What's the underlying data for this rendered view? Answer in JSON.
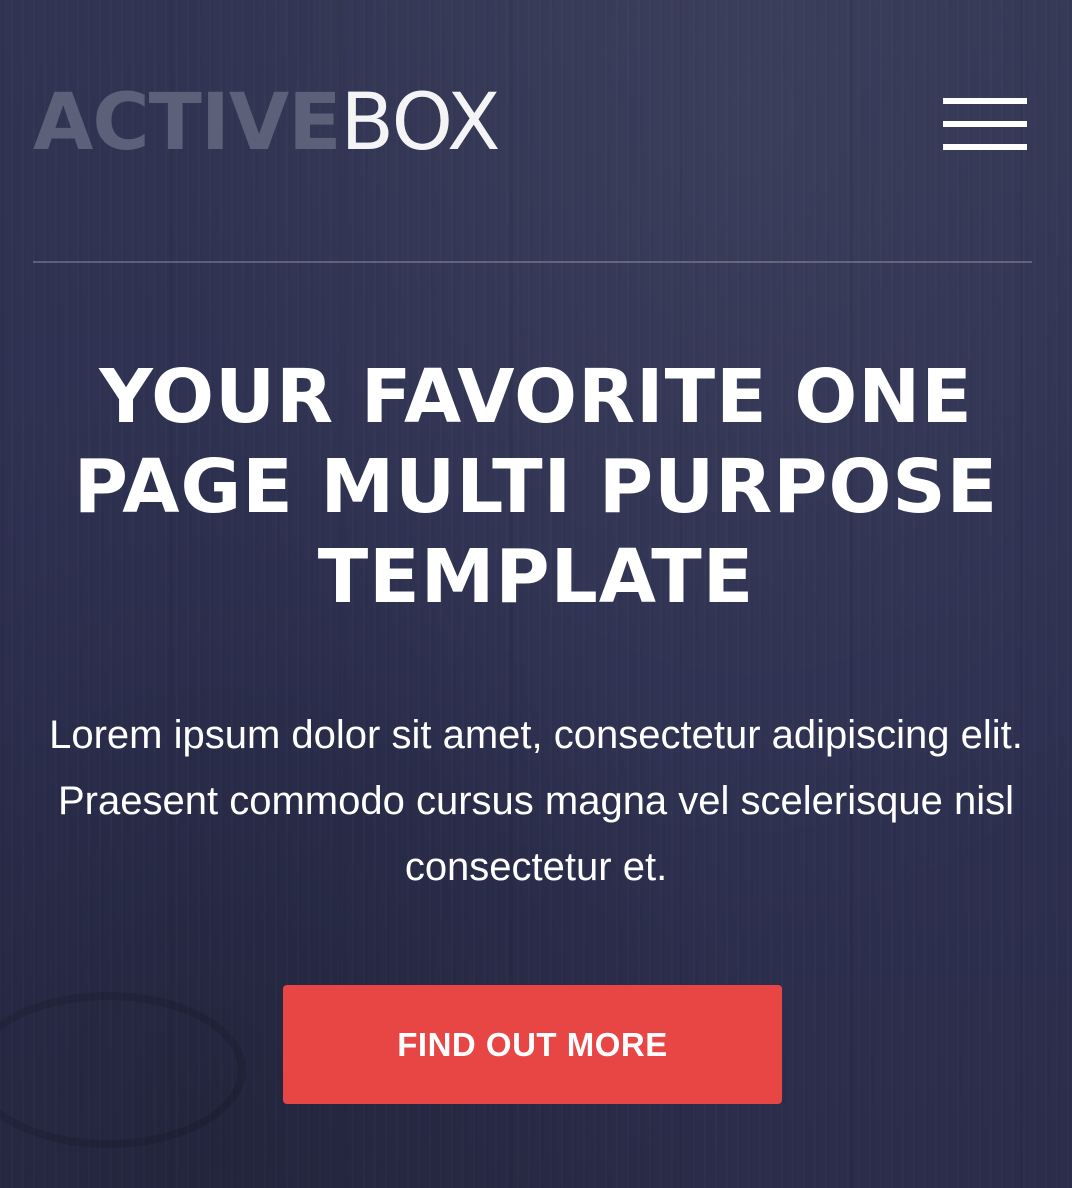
{
  "header": {
    "logo_bold": "ACTIVE",
    "logo_light": "BOX",
    "menu_icon": "hamburger-menu-icon"
  },
  "hero": {
    "title": "YOUR FAVORITE ONE PAGE MULTI PURPOSE TEMPLATE",
    "description": "Lorem ipsum dolor sit amet, consectetur adipiscing elit. Praesent commodo cursus magna vel scelerisque nisl consectetur et.",
    "cta_label": "FIND OUT MORE"
  },
  "colors": {
    "background": "#2f3250",
    "logo_bold": "#5d6079",
    "accent": "#e84545",
    "text": "#ffffff"
  }
}
